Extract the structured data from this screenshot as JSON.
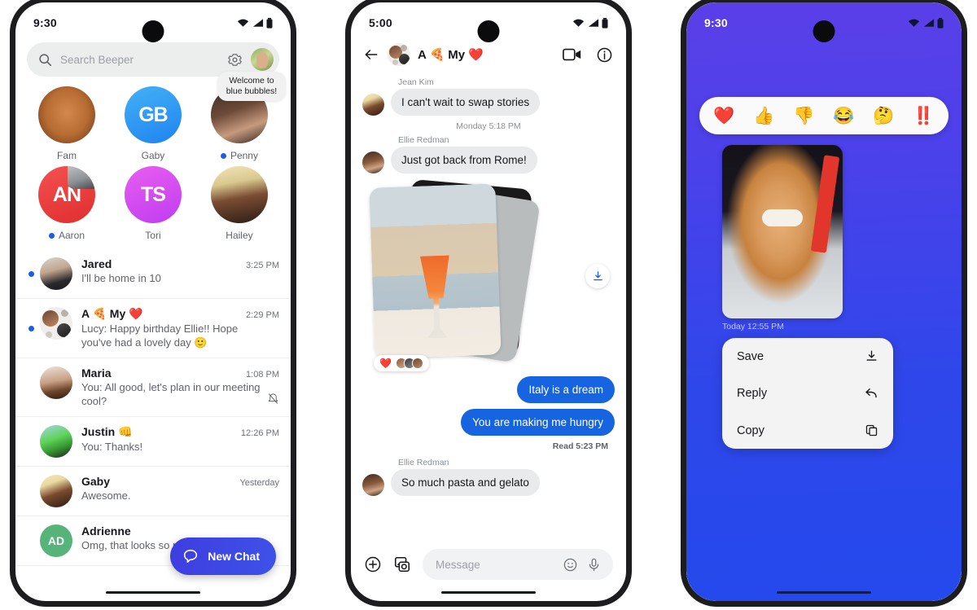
{
  "phone1": {
    "statusbar": {
      "time": "9:30",
      "wifi_icon": "wifi-icon",
      "signal_icon": "signal-icon",
      "battery_icon": "battery-icon"
    },
    "search": {
      "placeholder": "Search Beeper",
      "icon": "search-icon",
      "settings_icon": "gear-icon",
      "avatar": "profile-avatar"
    },
    "tiles": [
      {
        "label": "Fam",
        "kind": "photo",
        "pic": "pic-dogface",
        "unread": false,
        "monogram": "",
        "bg": "#efefef",
        "tooltip": ""
      },
      {
        "label": "Gaby",
        "kind": "monogram",
        "pic": "",
        "unread": false,
        "monogram": "GB",
        "bg": "#2f9cf2",
        "tooltip": ""
      },
      {
        "label": "Penny",
        "kind": "photo",
        "pic": "pic-woman1",
        "unread": true,
        "monogram": "",
        "bg": "#e8e6e4",
        "tooltip": "Welcome to blue bubbles!"
      },
      {
        "label": "Aaron",
        "kind": "monogram",
        "pic": "",
        "unread": true,
        "monogram": "AN",
        "bg": "#ef3c3c",
        "tooltip": ""
      },
      {
        "label": "Tori",
        "kind": "monogram",
        "pic": "",
        "unread": false,
        "monogram": "TS",
        "bg": "#d945e8",
        "tooltip": ""
      },
      {
        "label": "Hailey",
        "kind": "photo",
        "pic": "pic-woman2",
        "unread": false,
        "monogram": "",
        "bg": "#efeade",
        "tooltip": ""
      }
    ],
    "rows": [
      {
        "name": "Jared",
        "time": "3:25 PM",
        "preview": "I'll be home in 10",
        "unread": true,
        "muted": false,
        "pic": "pic-man1",
        "monogram": "",
        "bg": "#d8d8d8"
      },
      {
        "name": "A 🍕 My ❤️",
        "time": "2:29 PM",
        "preview": "Lucy: Happy birthday Ellie!! Hope you've had a lovely day  🙂",
        "unread": true,
        "muted": false,
        "pic": "group",
        "monogram": "",
        "bg": "#f0eeeb"
      },
      {
        "name": "Maria",
        "time": "1:08 PM",
        "preview": "You: All good, let's plan in our meeting cool?",
        "unread": false,
        "muted": true,
        "pic": "pic-woman4",
        "monogram": "",
        "bg": "#ddd6cf"
      },
      {
        "name": "Justin 👊",
        "time": "12:26 PM",
        "preview": "You: Thanks!",
        "unread": false,
        "muted": false,
        "pic": "pic-man2",
        "monogram": "",
        "bg": "#bfe3ef"
      },
      {
        "name": "Gaby",
        "time": "Yesterday",
        "preview": "Awesome.",
        "unread": false,
        "muted": false,
        "pic": "pic-woman3",
        "monogram": "",
        "bg": "#f5edc0"
      },
      {
        "name": "Adrienne",
        "time": "",
        "preview": "Omg, that looks so nice!",
        "unread": false,
        "muted": false,
        "pic": "",
        "monogram": "AD",
        "bg": "#56b47a"
      }
    ],
    "fab": {
      "label": "New Chat",
      "icon": "chat-bubble-icon",
      "color": "#3f3de0"
    }
  },
  "phone2": {
    "statusbar": {
      "time": "5:00"
    },
    "header": {
      "title": "A 🍕 My ❤️",
      "back_icon": "back-arrow-icon",
      "video_icon": "video-call-icon",
      "info_icon": "info-icon",
      "avatar": "group-avatar"
    },
    "messages": [
      {
        "type": "incoming",
        "sender": "Jean Kim",
        "text": "I can't wait to swap stories"
      },
      {
        "type": "daystamp",
        "sender": "",
        "text": "Monday 5:18 PM"
      },
      {
        "type": "incoming",
        "sender": "Ellie Redman",
        "text": "Just got back from Rome!"
      },
      {
        "type": "photostack",
        "sender": "",
        "text": ""
      },
      {
        "type": "outgoing",
        "sender": "",
        "text": "Italy is a dream"
      },
      {
        "type": "outgoing",
        "sender": "",
        "text": "You are making me hungry"
      },
      {
        "type": "readstamp",
        "sender": "",
        "text": "Read  5:23 PM"
      },
      {
        "type": "incoming",
        "sender": "Ellie Redman",
        "text": "So much pasta and gelato"
      }
    ],
    "photo_reaction": {
      "emoji": "❤️",
      "count_avatars": 3
    },
    "download_icon": "download-icon",
    "composer": {
      "plus_icon": "plus-circle-icon",
      "gallery_icon": "gallery-icon",
      "placeholder": "Message",
      "emoji_icon": "emoji-icon",
      "mic_icon": "microphone-icon"
    }
  },
  "phone3": {
    "statusbar": {
      "time": "9:30"
    },
    "background_gradient": [
      "#5b3fe8",
      "#2449ec"
    ],
    "reactions": [
      "❤️",
      "👍",
      "👎",
      "😂",
      "🤔",
      "‼️"
    ],
    "photo": {
      "alt": "dog-with-sunglasses-photo"
    },
    "timestamp": "Today  12:55 PM",
    "menu": [
      {
        "label": "Save",
        "icon": "download-icon"
      },
      {
        "label": "Reply",
        "icon": "reply-arrow-icon"
      },
      {
        "label": "Copy",
        "icon": "copy-icon"
      }
    ]
  }
}
